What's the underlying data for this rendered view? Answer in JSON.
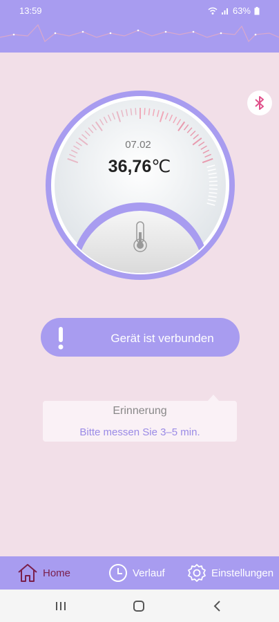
{
  "status_bar": {
    "time": "13:59",
    "battery": "63%",
    "icons": [
      "wifi-icon",
      "signal-icon",
      "battery-icon"
    ]
  },
  "measurement": {
    "date": "07.02",
    "temperature_value": "36,76",
    "temperature_unit": "℃"
  },
  "connection": {
    "label": "Gerät ist verbunden",
    "icon": "exclamation-icon"
  },
  "reminder": {
    "title": "Erinnerung",
    "text": "Bitte messen Sie 3–5 min."
  },
  "bottom_nav": {
    "items": [
      {
        "label": "Home",
        "icon": "home-icon",
        "active": true
      },
      {
        "label": "Verlauf",
        "icon": "clock-icon",
        "active": false
      },
      {
        "label": "Einstellungen",
        "icon": "gear-icon",
        "active": false
      }
    ]
  },
  "colors": {
    "accent": "#a89cf0",
    "background": "#f2dfe8",
    "active_nav": "#7a1e4a",
    "bluetooth": "#e0508a"
  }
}
